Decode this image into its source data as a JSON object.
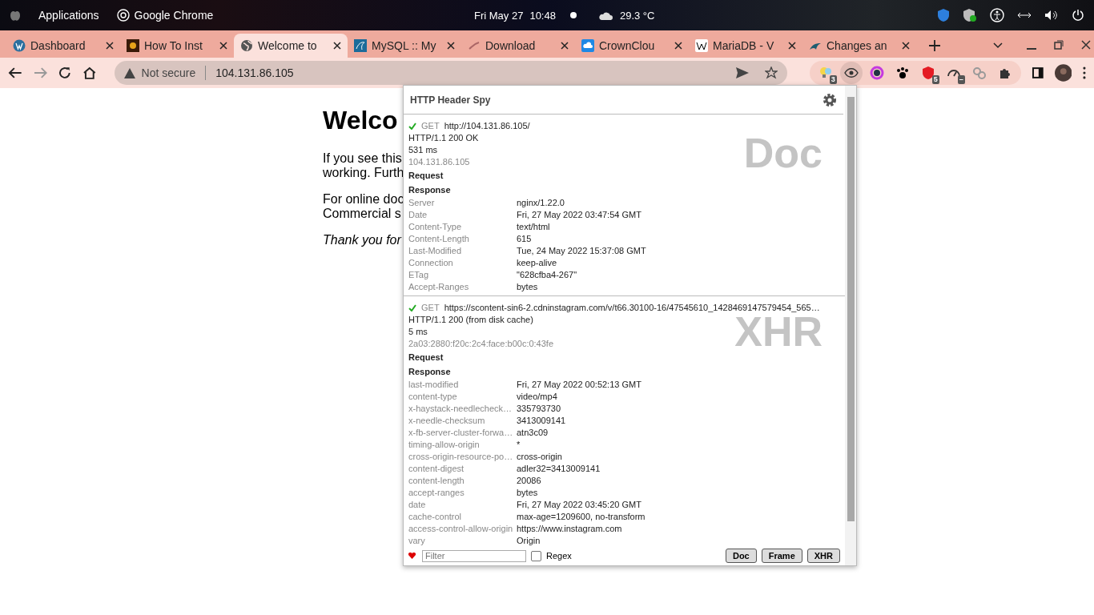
{
  "top_bar": {
    "apps": "Applications",
    "app": "Google Chrome",
    "date": "Fri May 27",
    "time": "10:48",
    "weather": "29.3 °C"
  },
  "tabs": [
    {
      "label": "Dashboard",
      "kind": "wp",
      "selected": false
    },
    {
      "label": "How To Inst",
      "kind": "sun",
      "selected": false
    },
    {
      "label": "Welcome to",
      "kind": "globe",
      "selected": true
    },
    {
      "label": "MySQL :: My",
      "kind": "mysql",
      "selected": false
    },
    {
      "label": "Download",
      "kind": "db",
      "selected": false
    },
    {
      "label": "CrownClou",
      "kind": "cloud",
      "selected": false
    },
    {
      "label": "MariaDB - V",
      "kind": "wiki",
      "selected": false
    },
    {
      "label": "Changes an",
      "kind": "seal",
      "selected": false
    }
  ],
  "address_bar": {
    "security": "Not secure",
    "url": "104.131.86.105"
  },
  "extensions": [
    {
      "kind": "bulb",
      "badge": "3",
      "selected": false
    },
    {
      "kind": "eye",
      "selected": true
    },
    {
      "kind": "ring",
      "selected": false
    },
    {
      "kind": "paw",
      "selected": false
    },
    {
      "kind": "shield",
      "badge": "5",
      "selected": false
    },
    {
      "kind": "gauge",
      "badge": "–",
      "selected": false
    },
    {
      "kind": "sq",
      "selected": false
    },
    {
      "kind": "puzzle",
      "selected": false
    }
  ],
  "page": {
    "heading": "Welco",
    "paragraphs": [
      {
        "italic": false,
        "lines": [
          "If you see this",
          "working. Furth"
        ]
      },
      {
        "italic": false,
        "lines": [
          "For online doc",
          "Commercial s"
        ]
      },
      {
        "italic": true,
        "lines": [
          "Thank you for"
        ]
      }
    ]
  },
  "popup": {
    "title": "HTTP Header Spy",
    "entries": [
      {
        "method": "GET",
        "url": "http://104.131.86.105/",
        "status": "HTTP/1.1 200 OK",
        "time": "531 ms",
        "ip": "104.131.86.105",
        "type": "Doc",
        "request": "Request",
        "response": "Response",
        "headers": [
          [
            "Server",
            "nginx/1.22.0"
          ],
          [
            "Date",
            "Fri, 27 May 2022 03:47:54 GMT"
          ],
          [
            "Content-Type",
            "text/html"
          ],
          [
            "Content-Length",
            "615"
          ],
          [
            "Last-Modified",
            "Tue, 24 May 2022 15:37:08 GMT"
          ],
          [
            "Connection",
            "keep-alive"
          ],
          [
            "ETag",
            "\"628cfba4-267\""
          ],
          [
            "Accept-Ranges",
            "bytes"
          ]
        ]
      },
      {
        "method": "GET",
        "url": "https://scontent-sin6-2.cdninstagram.com/v/t66.30100-16/47545610_1428469147579454_565…",
        "status": "HTTP/1.1 200 (from disk cache)",
        "time": "5 ms",
        "ip": "2a03:2880:f20c:2c4:face:b00c:0:43fe",
        "type": "XHR",
        "request": "Request",
        "response": "Response",
        "headers": [
          [
            "last-modified",
            "Fri, 27 May 2022 00:52:13 GMT"
          ],
          [
            "content-type",
            "video/mp4"
          ],
          [
            "x-haystack-needlecheck…",
            "335793730"
          ],
          [
            "x-needle-checksum",
            "3413009141"
          ],
          [
            "x-fb-server-cluster-forwa…",
            "atn3c09"
          ],
          [
            "timing-allow-origin",
            "*"
          ],
          [
            "cross-origin-resource-po…",
            "cross-origin"
          ],
          [
            "content-digest",
            "adler32=3413009141"
          ],
          [
            "content-length",
            "20086"
          ],
          [
            "accept-ranges",
            "bytes"
          ],
          [
            "date",
            "Fri, 27 May 2022 03:45:20 GMT"
          ],
          [
            "cache-control",
            "max-age=1209600, no-transform"
          ],
          [
            "access-control-allow-origin",
            "https://www.instagram.com"
          ],
          [
            "vary",
            "Origin"
          ]
        ]
      }
    ],
    "filter": {
      "placeholder": "Filter"
    },
    "regex": {
      "label": "Regex",
      "checked": false
    },
    "buttons": [
      "Doc",
      "Frame",
      "XHR"
    ]
  }
}
